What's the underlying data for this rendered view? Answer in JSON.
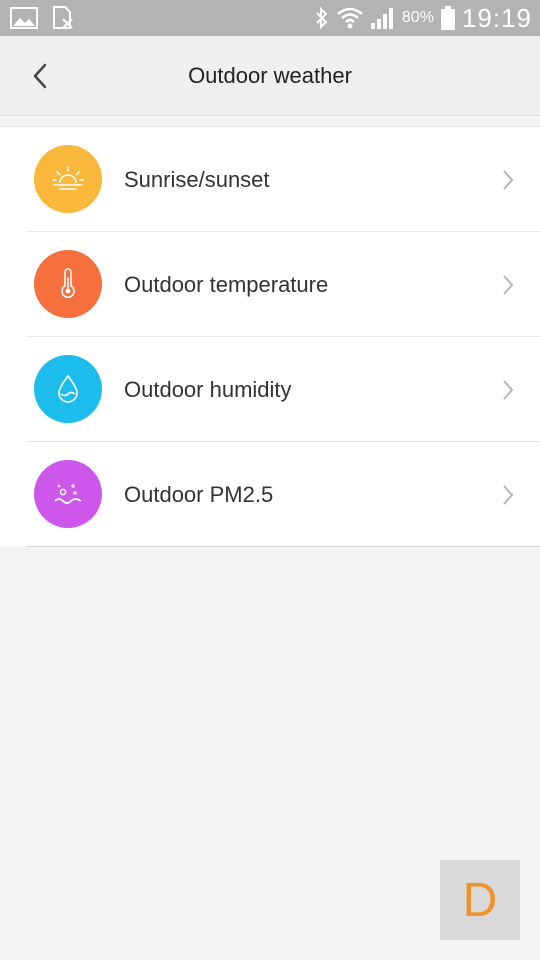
{
  "status_bar": {
    "battery": "80%",
    "time": "19:19"
  },
  "header": {
    "title": "Outdoor weather"
  },
  "items": [
    {
      "label": "Sunrise/sunset",
      "icon": "sunrise-icon",
      "color": "#f9b73b"
    },
    {
      "label": "Outdoor temperature",
      "icon": "thermometer-icon",
      "color": "#f6703d"
    },
    {
      "label": "Outdoor humidity",
      "icon": "water-drop-icon",
      "color": "#1cbcec"
    },
    {
      "label": "Outdoor PM2.5",
      "icon": "pm25-icon",
      "color": "#cd57ea"
    }
  ],
  "floating": {
    "label": "D",
    "color": "#f0922c"
  }
}
